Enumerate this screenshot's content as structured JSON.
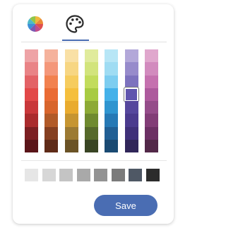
{
  "tabs": [
    {
      "icon": "color-wheel-icon",
      "active": false
    },
    {
      "icon": "palette-icon",
      "active": true
    }
  ],
  "accent_color": "#4a6db3",
  "palette": [
    [
      "#eea3a6",
      "#e98386",
      "#e36266",
      "#e24848",
      "#c9373a",
      "#aa2b2d",
      "#7c1f22",
      "#5a1519"
    ],
    [
      "#f5b29c",
      "#f4977a",
      "#f2814f",
      "#ea6b34",
      "#d8652c",
      "#b15a28",
      "#853f21",
      "#5f2b18"
    ],
    [
      "#f9e0a5",
      "#f7d683",
      "#f6cc5e",
      "#f5bf3d",
      "#e9ab2e",
      "#c69531",
      "#9c7a33",
      "#6b5326"
    ],
    [
      "#e0eb9c",
      "#d2e47c",
      "#c2dc5c",
      "#a8cb42",
      "#8daa35",
      "#6f8a2e",
      "#56692a",
      "#394524"
    ],
    [
      "#b7e6f6",
      "#9fdcf3",
      "#7dcdf0",
      "#44b1e9",
      "#2f95d0",
      "#2679b5",
      "#215f94",
      "#1a4a72"
    ],
    [
      "#b3a8d9",
      "#978bcb",
      "#7d72be",
      "#6055ae",
      "#56479d",
      "#4b3b8e",
      "#3f3079",
      "#302659"
    ],
    [
      "#e0a7cd",
      "#d28bbe",
      "#c571af",
      "#ad5a9d",
      "#954c8a",
      "#823d77",
      "#6c3064",
      "#522848"
    ]
  ],
  "selected_swatch": {
    "column": 5,
    "row": 3,
    "color": "#6055ae"
  },
  "grays": [
    "#e6e6e6",
    "#d7d7d7",
    "#c4c4c4",
    "#a9a9a9",
    "#939393",
    "#7b7b7b",
    "#4f5865",
    "#2c2c2c"
  ],
  "save_label": "Save"
}
